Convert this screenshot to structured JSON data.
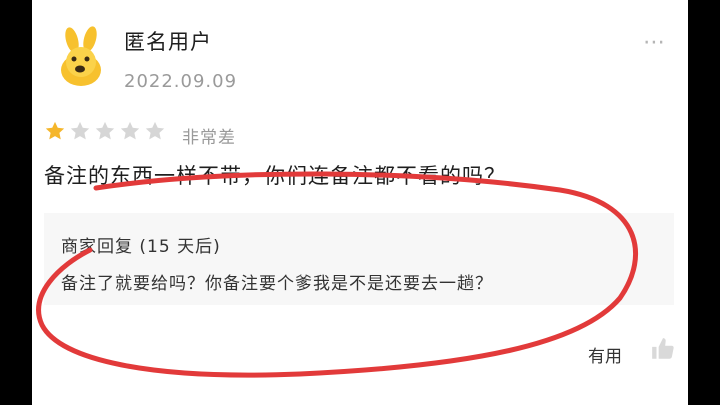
{
  "review": {
    "username": "匿名用户",
    "date": "2022.09.09",
    "more_icon": "⋯",
    "rating": {
      "filled": 1,
      "total": 5,
      "label": "非常差"
    },
    "comment": "备注的东西一样不带，你们连备注都不看的吗？"
  },
  "merchant_reply": {
    "title": "商家回复 (15 天后)",
    "text": "备注了就要给吗？你备注要个爹我是不是还要去一趟？"
  },
  "actions": {
    "useful_label": "有用"
  },
  "colors": {
    "star_filled": "#f5b62b",
    "star_empty": "#d6d6d6",
    "annotation_stroke": "#e23a3a",
    "reply_bg": "#f7f7f7"
  }
}
